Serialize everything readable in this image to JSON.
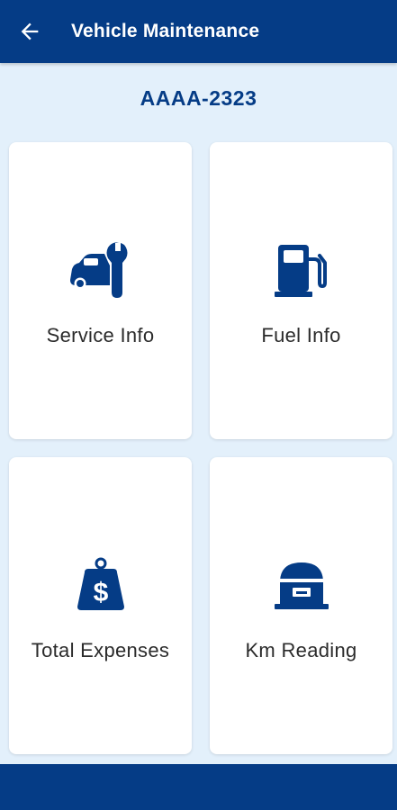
{
  "appbar": {
    "title": "Vehicle Maintenance",
    "back_icon": "arrow-left-icon"
  },
  "vehicle": {
    "plate": "AAAA-2323"
  },
  "tiles": [
    {
      "label": "Service Info",
      "icon": "car-wrench-icon"
    },
    {
      "label": "Fuel Info",
      "icon": "fuel-pump-icon"
    },
    {
      "label": "Total Expenses",
      "icon": "money-bag-icon"
    },
    {
      "label": "Km Reading",
      "icon": "odometer-icon"
    }
  ],
  "colors": {
    "primary": "#053c86",
    "background": "#e3f0fb",
    "card": "#ffffff",
    "label": "#2b2b2b"
  }
}
